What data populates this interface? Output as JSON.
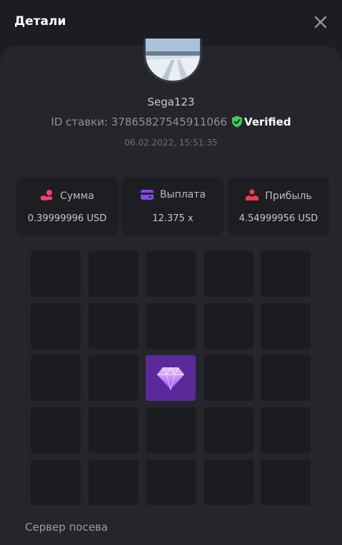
{
  "header": {
    "title": "Детали",
    "close_icon": "close-icon"
  },
  "profile": {
    "username": "Sega123",
    "bet_id_label": "ID ставки: 37865827545911066",
    "verified_label": "Verified",
    "date": "06.02.2022, 15:51:35"
  },
  "stats": [
    {
      "label": "Сумма",
      "value": "0.39999996 USD",
      "icon": "coin-hand-icon",
      "color": "#ff3d6e"
    },
    {
      "label": "Выплата",
      "value": "12.375 x",
      "icon": "card-icon",
      "color": "#8a45ff"
    },
    {
      "label": "Прибыль",
      "value": "4.54999956 USD",
      "icon": "profit-hand-icon",
      "color": "#ff3a45"
    }
  ],
  "board": {
    "rows": 5,
    "cols": 5,
    "gem_cell": {
      "row": 3,
      "col": 3
    }
  },
  "seed_section": {
    "label": "Сервер посева"
  },
  "colors": {
    "background": "#1c1d22",
    "panel": "#25262b",
    "tile": "#1b1c20",
    "gem_tile": "#5a2a9a",
    "verified_green": "#3ccf5a"
  }
}
